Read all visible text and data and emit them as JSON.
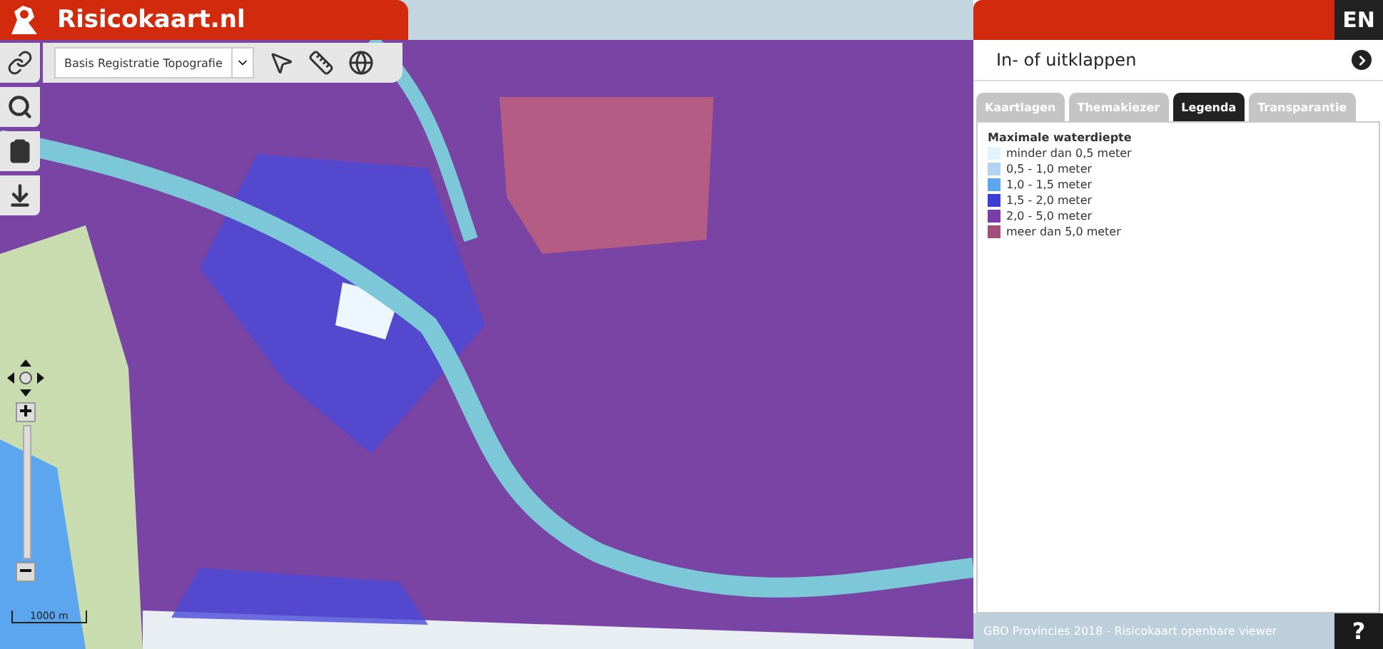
{
  "header": {
    "title": "Risicokaart.nl",
    "language": "EN"
  },
  "map_toolbar": {
    "basemap": "Basis Registratie Topografie"
  },
  "scale_bar": "1000 m",
  "panel": {
    "toggle": "In- of uitklappen",
    "tabs": [
      {
        "label": "Kaartlagen",
        "selected": false
      },
      {
        "label": "Themakiezer",
        "selected": false
      },
      {
        "label": "Legenda",
        "selected": true
      },
      {
        "label": "Transparantie",
        "selected": false
      }
    ],
    "legend": {
      "title": "Maximale waterdiepte",
      "items": [
        {
          "label": "minder dan 0,5 meter",
          "color": "#dff4ff"
        },
        {
          "label": "0,5 - 1,0 meter",
          "color": "#b3d3f4"
        },
        {
          "label": "1,0 - 1,5 meter",
          "color": "#5ca6ef"
        },
        {
          "label": "1,5 - 2,0 meter",
          "color": "#3c3cd6"
        },
        {
          "label": "2,0 - 5,0 meter",
          "color": "#7b3da8"
        },
        {
          "label": "meer dan 5,0 meter",
          "color": "#a34d7c"
        }
      ]
    }
  },
  "footer": {
    "text": "GBO Provincies 2018 - Risicokaart openbare viewer",
    "help": "?"
  }
}
